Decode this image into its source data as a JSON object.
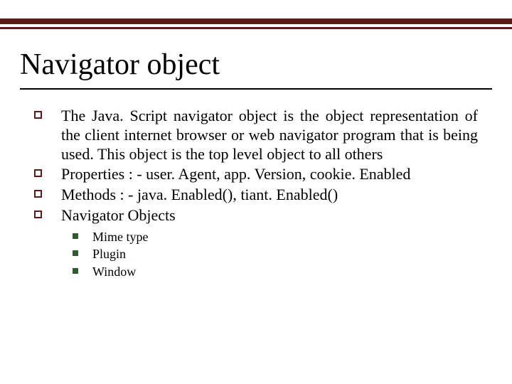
{
  "title": "Navigator object",
  "bullets": [
    "The Java. Script navigator object is the object representation of the client internet browser or web navigator program that is being used. This object is the top level object to all others",
    "Properties : - user. Agent, app. Version, cookie. Enabled",
    "Methods : - java. Enabled(), tiant. Enabled()",
    "Navigator Objects"
  ],
  "sub_bullets": [
    "Mime type",
    "Plugin",
    "Window"
  ],
  "colors": {
    "rule": "#5a1a1a",
    "sub_bullet": "#2e5a2e"
  }
}
